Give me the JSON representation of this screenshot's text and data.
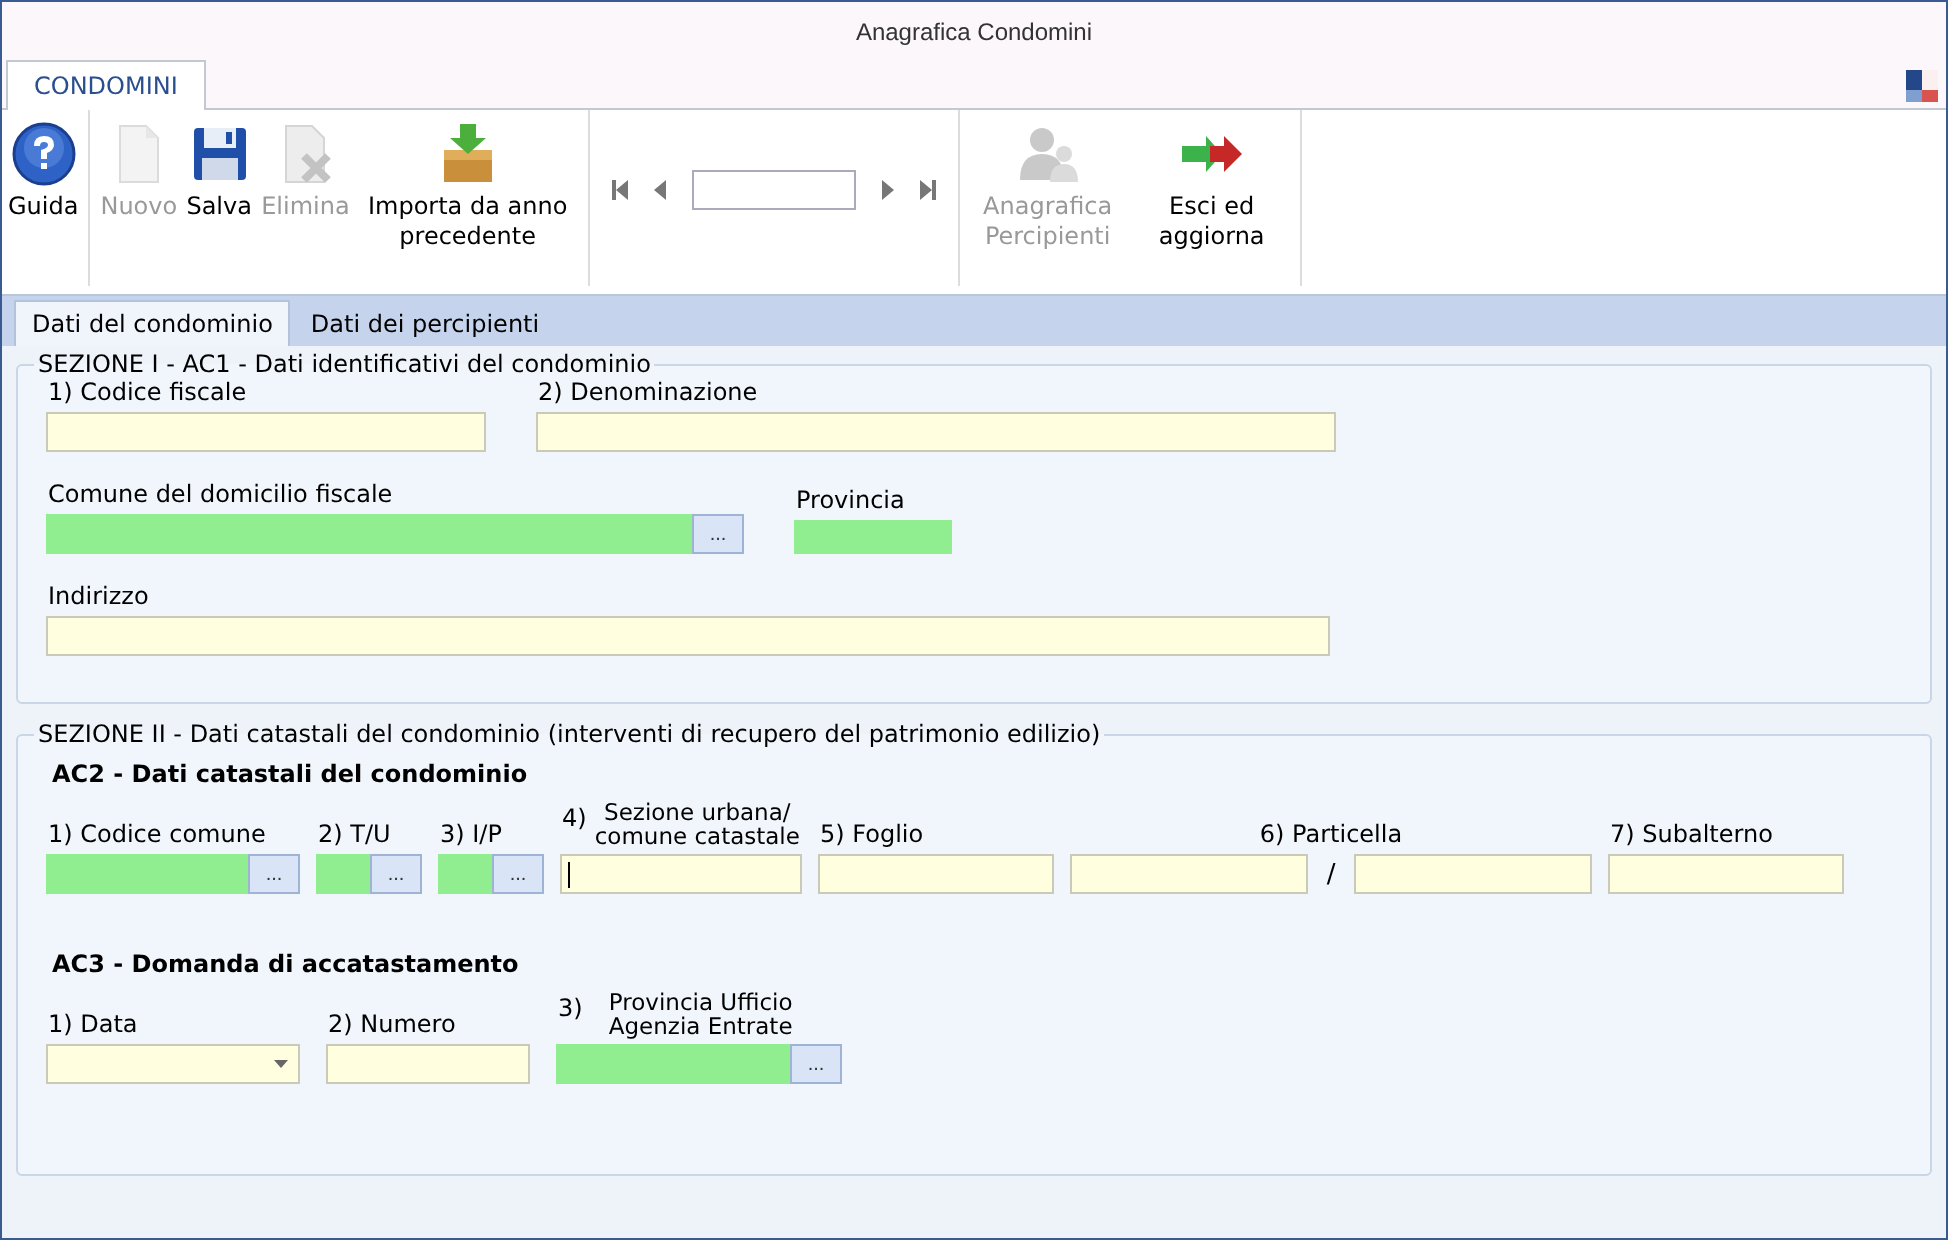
{
  "window": {
    "title": "Anagrafica Condomini"
  },
  "ribbon_tabs": [
    {
      "label": "CONDOMINI",
      "selected": true
    }
  ],
  "toolbar": {
    "groups": [
      {
        "kind": "buttons",
        "items": [
          {
            "label": "Guida",
            "disabled": false
          }
        ]
      },
      {
        "kind": "buttons",
        "items": [
          {
            "label": "Nuovo",
            "disabled": true
          },
          {
            "label": "Salva",
            "disabled": false
          },
          {
            "label": "Elimina",
            "disabled": true
          },
          {
            "label": "Importa da anno precedente",
            "disabled": false
          }
        ]
      },
      {
        "kind": "navigator"
      },
      {
        "kind": "buttons",
        "items": [
          {
            "label": "Anagrafica Percipienti",
            "disabled": true
          },
          {
            "label": "Esci ed aggiorna",
            "disabled": false
          }
        ]
      }
    ]
  },
  "page_tabs": [
    {
      "label": "Dati del condominio",
      "selected": true
    },
    {
      "label": "Dati dei percipienti",
      "selected": false
    }
  ],
  "sections": [
    {
      "title": "SEZIONE I - AC1 - Dati identificativi del condominio",
      "blocks": [
        {
          "rows": [
            [
              {
                "label": "1) Codice fiscale",
                "kind": "text"
              },
              {
                "label": "2) Denominazione",
                "kind": "text"
              }
            ],
            [
              {
                "label": "Comune del domicilio fiscale",
                "kind": "lookup",
                "button": "..."
              },
              {
                "label": "Provincia",
                "kind": "readonly"
              }
            ],
            [
              {
                "label": "Indirizzo",
                "kind": "text"
              }
            ]
          ]
        }
      ]
    },
    {
      "title": "SEZIONE II - Dati catastali del condominio (interventi di recupero del patrimonio edilizio)",
      "blocks": [
        {
          "heading": "AC2 - Dati catastali del condominio",
          "rows": [
            [
              {
                "label": "1) Codice comune",
                "kind": "lookup",
                "button": "..."
              },
              {
                "label": "2) T/U",
                "kind": "lookup",
                "button": "..."
              },
              {
                "label": "3) I/P",
                "kind": "lookup",
                "button": "..."
              },
              {
                "number": "4)",
                "label": "Sezione urbana/ comune catastale",
                "kind": "text",
                "focused": true
              },
              {
                "label": "5) Foglio",
                "kind": "text"
              },
              {
                "label": "6) Particella",
                "kind": "split",
                "separator": "/"
              },
              {
                "label": "7) Subalterno",
                "kind": "text"
              }
            ]
          ]
        },
        {
          "heading": "AC3 - Domanda di accatastamento",
          "rows": [
            [
              {
                "label": "1) Data",
                "kind": "date"
              },
              {
                "label": "2) Numero",
                "kind": "text"
              },
              {
                "number": "3)",
                "label": "Provincia Ufficio Agenzia Entrate",
                "kind": "lookup",
                "button": "..."
              }
            ]
          ]
        }
      ]
    }
  ]
}
